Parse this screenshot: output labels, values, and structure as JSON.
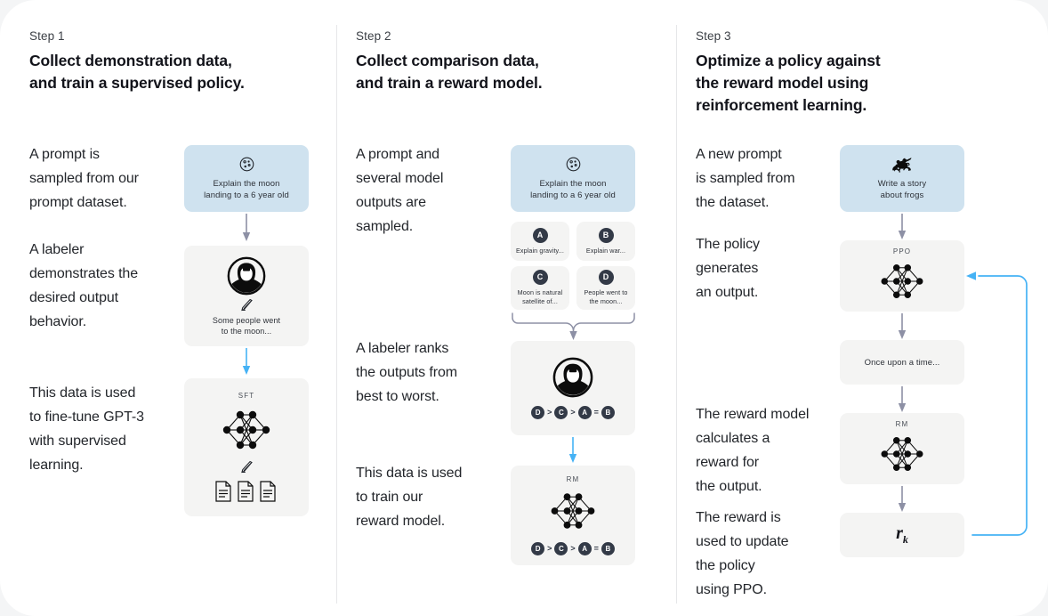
{
  "theme": {
    "card_bg": "#ffffff",
    "page_bg": "#f4f5f6",
    "box_gray": "#f4f4f3",
    "box_blue": "#cfe2ef",
    "arrow_gray": "#8d90a5",
    "arrow_blue": "#45b2f5",
    "text": "#23262b"
  },
  "columns": [
    {
      "step_label": "Step 1",
      "step_title": "Collect demonstration data,\nand train a supervised policy.",
      "paragraphs": [
        "A prompt is\nsampled from our\nprompt dataset.",
        "A labeler\ndemonstrates the\ndesired output\nbehavior.",
        "This data is used\nto fine-tune GPT-3\nwith supervised\nlearning."
      ],
      "prompt_box": {
        "icon": "moon-icon",
        "caption": "Explain the moon\nlanding to a 6 year old"
      },
      "labeler_box": {
        "icon": "labeler-avatar-icon",
        "pencil": "pencil-icon",
        "caption": "Some people went\nto the moon..."
      },
      "model_box": {
        "tag": "SFT",
        "icon": "neural-network-icon",
        "pencil": "pencil-icon",
        "docs": "documents-icon"
      }
    },
    {
      "step_label": "Step 2",
      "step_title": "Collect comparison data,\nand train a reward model.",
      "paragraphs": [
        "A prompt and\nseveral model\noutputs are\nsampled.",
        "A labeler ranks\nthe outputs from\nbest to worst.",
        "This data is used\nto train our\nreward model."
      ],
      "prompt_box": {
        "icon": "moon-icon",
        "caption": "Explain the moon\nlanding to a 6 year old"
      },
      "outputs": [
        {
          "letter": "A",
          "caption": "Explain gravity..."
        },
        {
          "letter": "B",
          "caption": "Explain war..."
        },
        {
          "letter": "C",
          "caption": "Moon is natural\nsatellite of..."
        },
        {
          "letter": "D",
          "caption": "People went to\nthe moon..."
        }
      ],
      "ranking_box": {
        "icon": "labeler-avatar-icon",
        "ranking": [
          "D",
          ">",
          "C",
          ">",
          "A",
          "=",
          "B"
        ]
      },
      "reward_model_box": {
        "tag": "RM",
        "icon": "neural-network-icon",
        "ranking": [
          "D",
          ">",
          "C",
          ">",
          "A",
          "=",
          "B"
        ]
      }
    },
    {
      "step_label": "Step 3",
      "step_title": "Optimize a policy against\nthe reward model using\nreinforcement learning.",
      "paragraphs": [
        "A new prompt\nis sampled from\nthe dataset.",
        "The policy\ngenerates\nan output.",
        "The reward model\ncalculates a\nreward for\nthe output.",
        "The reward is\nused to update\nthe policy\nusing PPO."
      ],
      "prompt_box": {
        "icon": "frog-icon",
        "caption": "Write a story\nabout frogs"
      },
      "policy_box": {
        "tag": "PPO",
        "icon": "neural-network-icon"
      },
      "output_box": {
        "caption": "Once upon a time..."
      },
      "reward_model_box": {
        "tag": "RM",
        "icon": "neural-network-icon"
      },
      "reward_box": {
        "symbol": "r",
        "subscript": "k"
      }
    }
  ]
}
